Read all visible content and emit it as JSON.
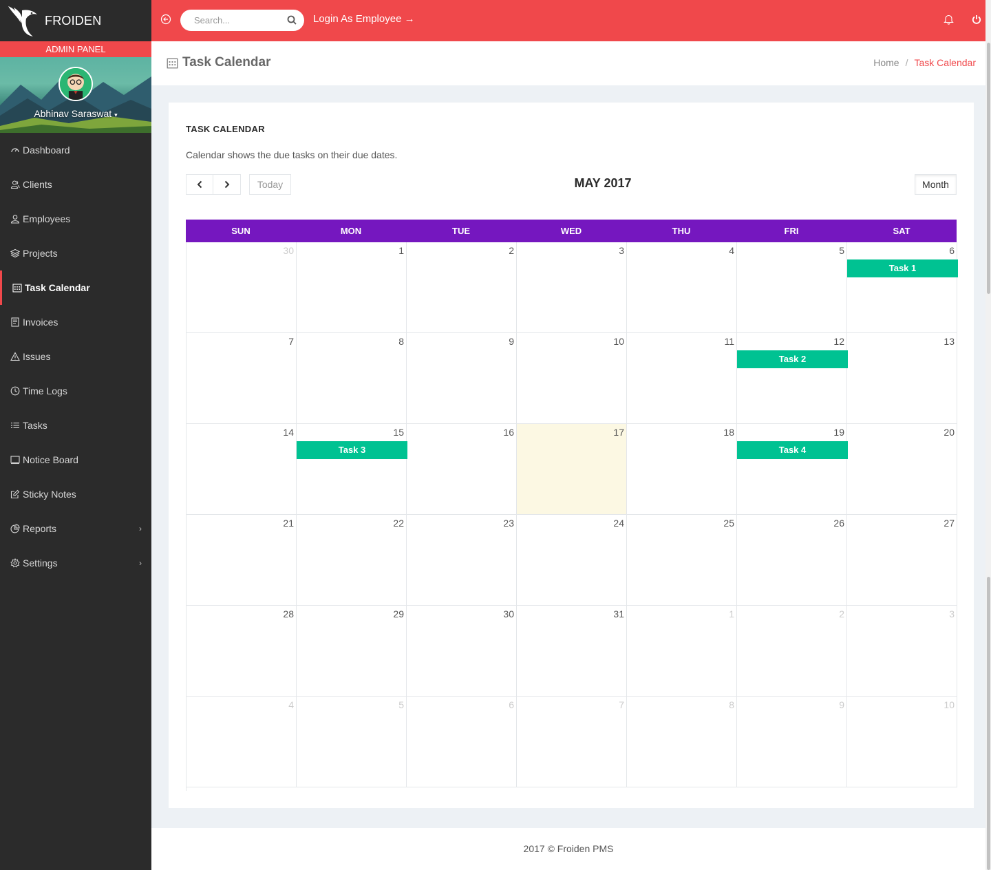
{
  "brand": {
    "name": "FROIDEN",
    "panel_label": "ADMIN PANEL"
  },
  "user": {
    "name": "Abhinav Saraswat",
    "caret": "▾"
  },
  "sidebar": {
    "items": [
      {
        "label": "Dashboard",
        "icon": "dashboard-icon"
      },
      {
        "label": "Clients",
        "icon": "users-icon"
      },
      {
        "label": "Employees",
        "icon": "user-icon"
      },
      {
        "label": "Projects",
        "icon": "layers-icon"
      },
      {
        "label": "Task Calendar",
        "icon": "calendar-icon",
        "active": true
      },
      {
        "label": "Invoices",
        "icon": "invoice-icon"
      },
      {
        "label": "Issues",
        "icon": "alert-icon"
      },
      {
        "label": "Time Logs",
        "icon": "clock-icon"
      },
      {
        "label": "Tasks",
        "icon": "list-icon"
      },
      {
        "label": "Notice Board",
        "icon": "notice-icon"
      },
      {
        "label": "Sticky Notes",
        "icon": "edit-icon"
      },
      {
        "label": "Reports",
        "icon": "pie-icon",
        "arrow": "›"
      },
      {
        "label": "Settings",
        "icon": "gear-icon",
        "arrow": "›"
      }
    ]
  },
  "topbar": {
    "search_placeholder": "Search...",
    "login_as_employee": "Login As Employee →"
  },
  "page": {
    "title": "Task Calendar",
    "breadcrumb_home": "Home",
    "breadcrumb_sep": "/",
    "breadcrumb_current": "Task Calendar"
  },
  "panel": {
    "title": "TASK CALENDAR",
    "description": "Calendar shows the due tasks on their due dates."
  },
  "calendar": {
    "today_label": "Today",
    "title": "MAY 2017",
    "view_label": "Month",
    "weekdays": [
      "SUN",
      "MON",
      "TUE",
      "WED",
      "THU",
      "FRI",
      "SAT"
    ],
    "weeks": [
      [
        {
          "d": "30",
          "o": true
        },
        {
          "d": "1"
        },
        {
          "d": "2"
        },
        {
          "d": "3"
        },
        {
          "d": "4"
        },
        {
          "d": "5"
        },
        {
          "d": "6"
        }
      ],
      [
        {
          "d": "7"
        },
        {
          "d": "8"
        },
        {
          "d": "9"
        },
        {
          "d": "10"
        },
        {
          "d": "11"
        },
        {
          "d": "12"
        },
        {
          "d": "13"
        }
      ],
      [
        {
          "d": "14"
        },
        {
          "d": "15"
        },
        {
          "d": "16"
        },
        {
          "d": "17",
          "today": true
        },
        {
          "d": "18"
        },
        {
          "d": "19"
        },
        {
          "d": "20"
        }
      ],
      [
        {
          "d": "21"
        },
        {
          "d": "22"
        },
        {
          "d": "23"
        },
        {
          "d": "24"
        },
        {
          "d": "25"
        },
        {
          "d": "26"
        },
        {
          "d": "27"
        }
      ],
      [
        {
          "d": "28"
        },
        {
          "d": "29"
        },
        {
          "d": "30"
        },
        {
          "d": "31"
        },
        {
          "d": "1",
          "o": true
        },
        {
          "d": "2",
          "o": true
        },
        {
          "d": "3",
          "o": true
        }
      ],
      [
        {
          "d": "4",
          "o": true
        },
        {
          "d": "5",
          "o": true
        },
        {
          "d": "6",
          "o": true
        },
        {
          "d": "7",
          "o": true
        },
        {
          "d": "8",
          "o": true
        },
        {
          "d": "9",
          "o": true
        },
        {
          "d": "10",
          "o": true
        }
      ]
    ],
    "events": [
      {
        "title": "Task 1",
        "week": 0,
        "day": 6
      },
      {
        "title": "Task 2",
        "week": 1,
        "day": 5
      },
      {
        "title": "Task 3",
        "week": 2,
        "day": 1
      },
      {
        "title": "Task 4",
        "week": 2,
        "day": 5
      }
    ],
    "event_color": "#00c292",
    "header_color": "#7517bf"
  },
  "footer": {
    "text": "2017 © Froiden PMS"
  },
  "colors": {
    "accent": "#f0484b",
    "sidebar_bg": "#2b2b2b"
  }
}
